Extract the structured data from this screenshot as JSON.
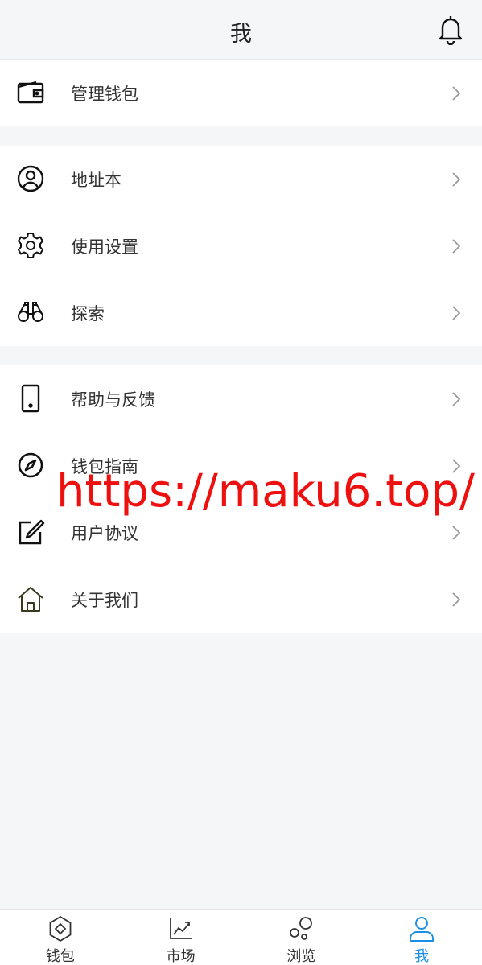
{
  "header": {
    "title": "我"
  },
  "groups": [
    {
      "items": [
        {
          "label": "管理钱包",
          "icon": "wallet-icon"
        }
      ]
    },
    {
      "items": [
        {
          "label": "地址本",
          "icon": "user-circle-icon"
        },
        {
          "label": "使用设置",
          "icon": "gear-icon"
        },
        {
          "label": "探索",
          "icon": "binoculars-icon"
        }
      ]
    },
    {
      "items": [
        {
          "label": "帮助与反馈",
          "icon": "phone-icon"
        },
        {
          "label": "钱包指南",
          "icon": "compass-icon"
        },
        {
          "label": "用户协议",
          "icon": "edit-icon"
        },
        {
          "label": "关于我们",
          "icon": "home-icon"
        }
      ]
    }
  ],
  "watermark": "https://maku6.top/",
  "tabs": [
    {
      "label": "钱包",
      "icon": "wallet-tab-icon",
      "active": false
    },
    {
      "label": "市场",
      "icon": "chart-icon",
      "active": false
    },
    {
      "label": "浏览",
      "icon": "bubbles-icon",
      "active": false
    },
    {
      "label": "我",
      "icon": "person-icon",
      "active": true
    }
  ],
  "colors": {
    "accent": "#1a8fe3",
    "background": "#f5f6f8",
    "watermark": "#ee0f0f"
  }
}
